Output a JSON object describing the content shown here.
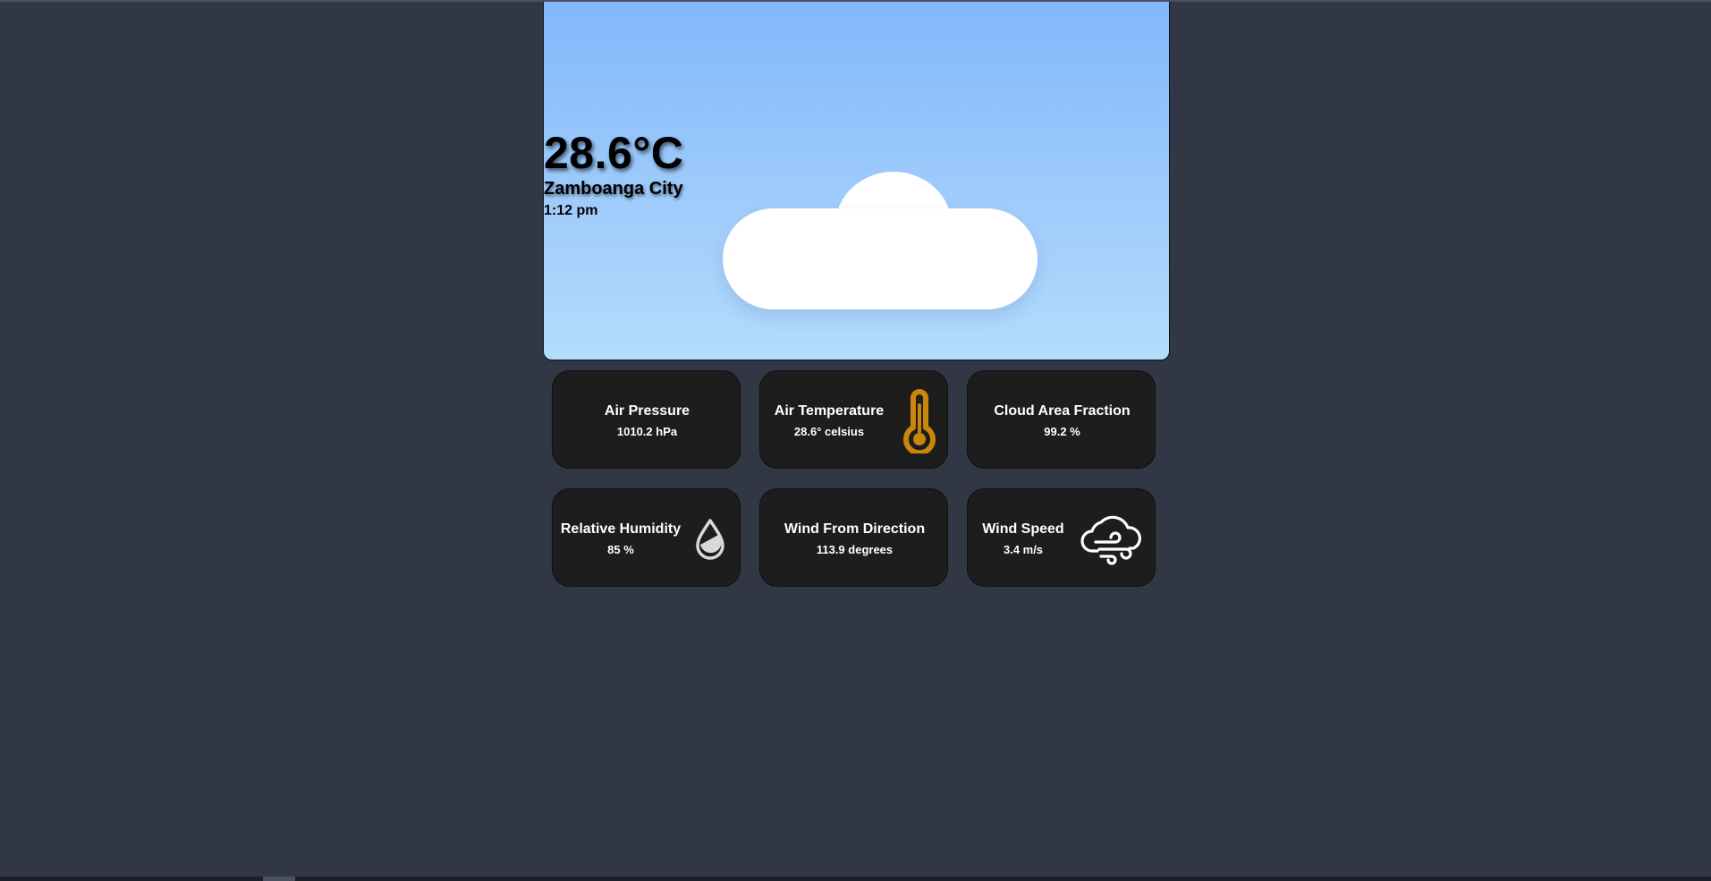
{
  "hero": {
    "temperature": "28.6°C",
    "city": "Zamboanga City",
    "time": "1:12 pm",
    "condition_icon": "cloud-icon"
  },
  "cards": [
    {
      "title": "Air Pressure",
      "value": "1010.2 hPa",
      "icon": null
    },
    {
      "title": "Air Temperature",
      "value": "28.6° celsius",
      "icon": "thermometer-icon"
    },
    {
      "title": "Cloud Area Fraction",
      "value": "99.2 %",
      "icon": null
    },
    {
      "title": "Relative Humidity",
      "value": "85 %",
      "icon": "droplet-icon"
    },
    {
      "title": "Wind From Direction",
      "value": "113.9 degrees",
      "icon": null
    },
    {
      "title": "Wind Speed",
      "value": "3.4 m/s",
      "icon": "cloud-wind-icon"
    }
  ],
  "colors": {
    "background": "#313745",
    "card": "#1d1d1e",
    "thermometer": "#c8860a",
    "sky_top": "#80b8fb",
    "sky_bottom": "#b3dcfc"
  }
}
